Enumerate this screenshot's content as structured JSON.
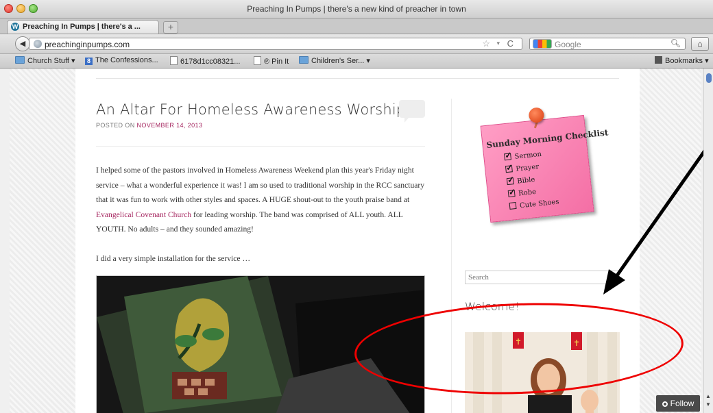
{
  "window": {
    "title": "Preaching In Pumps | there's a new kind of preacher in town"
  },
  "tab": {
    "label": "Preaching In Pumps | there's a ...",
    "new_tab_symbol": "+"
  },
  "navbar": {
    "url": "preachinginpumps.com",
    "search_engine": "Google"
  },
  "bookmarks": [
    {
      "label": "Church Stuff ▾",
      "icon": "folder-icon"
    },
    {
      "label": "The Confessions...",
      "icon": "blue-g-icon"
    },
    {
      "label": "6178d1cc08321...",
      "icon": "page-icon"
    },
    {
      "label": "℗ Pin It",
      "icon": "page-icon"
    },
    {
      "label": "Children's Ser... ▾",
      "icon": "folder-icon"
    }
  ],
  "bookmarks_menu": "Bookmarks ▾",
  "post": {
    "title": "An Altar For Homeless Awareness Worship",
    "meta_prefix": "POSTED ON ",
    "date": "NOVEMBER 14, 2013",
    "para1_before": "I helped some of the pastors involved in Homeless Awareness Weekend plan this year's Friday night service – what a wonderful experience it was!  I am so used to traditional worship in the RCC sanctuary that it was fun to work with other styles and spaces.  A HUGE shout-out to the youth praise band at ",
    "para1_link": "Evangelical Covenant Church",
    "para1_after": " for leading worship.  The band was comprised of ALL youth.  ALL YOUTH.  No adults – and they sounded amazing!",
    "para2": "I did a very simple installation for the service …"
  },
  "sidebar": {
    "note_title": "Sunday Morning Checklist",
    "checklist": [
      {
        "label": "Sermon",
        "checked": true
      },
      {
        "label": "Prayer",
        "checked": true
      },
      {
        "label": "Bible",
        "checked": true
      },
      {
        "label": "Robe",
        "checked": true
      },
      {
        "label": "Cute Shoes",
        "checked": false
      }
    ],
    "search_placeholder": "Search",
    "welcome": "Welcome!"
  },
  "follow": {
    "label": "Follow"
  },
  "colors": {
    "link": "#a5255f",
    "annotation": "#e00000",
    "note_pink": "#f46fa5"
  }
}
